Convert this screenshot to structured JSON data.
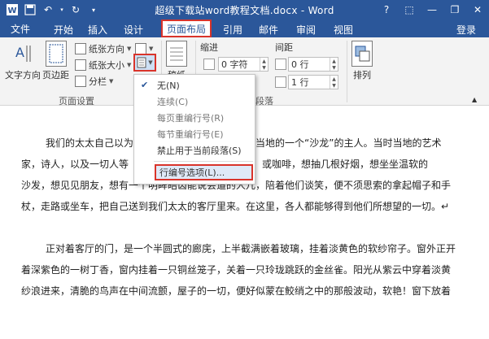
{
  "window": {
    "title": "超级下载站word教程文档.docx - Word",
    "minimize": "—",
    "restore": "❐",
    "close": "✕"
  },
  "qat": {
    "save_icon": "save-icon",
    "undo_icon": "undo-icon",
    "redo_icon": "redo-icon",
    "customize_icon": "customize-qat-icon"
  },
  "tabs": {
    "file": "文件",
    "items": [
      "开始",
      "插入",
      "设计",
      "页面布局",
      "引用",
      "邮件",
      "审阅",
      "视图"
    ],
    "active": "页面布局",
    "login": "登录"
  },
  "ribbon": {
    "text_direction": "文字方向",
    "margins": "页边距",
    "orientation": "纸张方向",
    "size": "纸张大小",
    "columns": "分栏",
    "page_setup_label": "页面设置",
    "manuscript": "稿纸",
    "indent_label": "缩进",
    "spacing_label": "间距",
    "indent_left": "0 字符",
    "spacing_before": "0 行",
    "spacing_after": "1 行",
    "paragraph_label": "段落",
    "arrange": "排列"
  },
  "line_numbers_menu": {
    "items": [
      {
        "label": "无(N)",
        "checked": true,
        "enabled": true
      },
      {
        "label": "连续(C)",
        "checked": false,
        "enabled": false
      },
      {
        "label": "每页重编行号(R)",
        "checked": false,
        "enabled": false
      },
      {
        "label": "每节重编行号(E)",
        "checked": false,
        "enabled": false
      },
      {
        "label": "禁止用于当前段落(S)",
        "checked": false,
        "enabled": true
      }
    ],
    "options": "行编号选项(L)..."
  },
  "document": {
    "para1": [
      "我们的太太自己以为",
      "家，诗人，以及一切人等",
      "沙发，想见见朋友，想有一个明眸皓齿能说会道的人儿，陪着他们谈笑，便不须思索的拿起帽子和手",
      "杖，走路或坐车，把自己送到我们太太的客厅里来。在这里，各人都能够得到他们所想望的一切。↵"
    ],
    "para1_tail1": "时当地的一个“沙龙”的主人。当时当地的艺术",
    "para1_tail2": "浓茶，或咖啡，想抽几根好烟，想坐坐温软的",
    "para2": [
      "正对着客厅的门，是一个半圆式的廊庑，上半截满嵌着玻璃，挂着淡黄色的软纱帘子。窗外正开",
      "着深紫色的一树丁香，窗内挂着一只铜丝笼子，关着一只玲珑跳跃的金丝雀。阳光从紫云中穿着淡黄",
      "纱浪进来，清脆的鸟声在中间流颤，屋子的一切，便好似蒙在鲛绡之中的那般波动，软艳！窗下放着"
    ]
  }
}
